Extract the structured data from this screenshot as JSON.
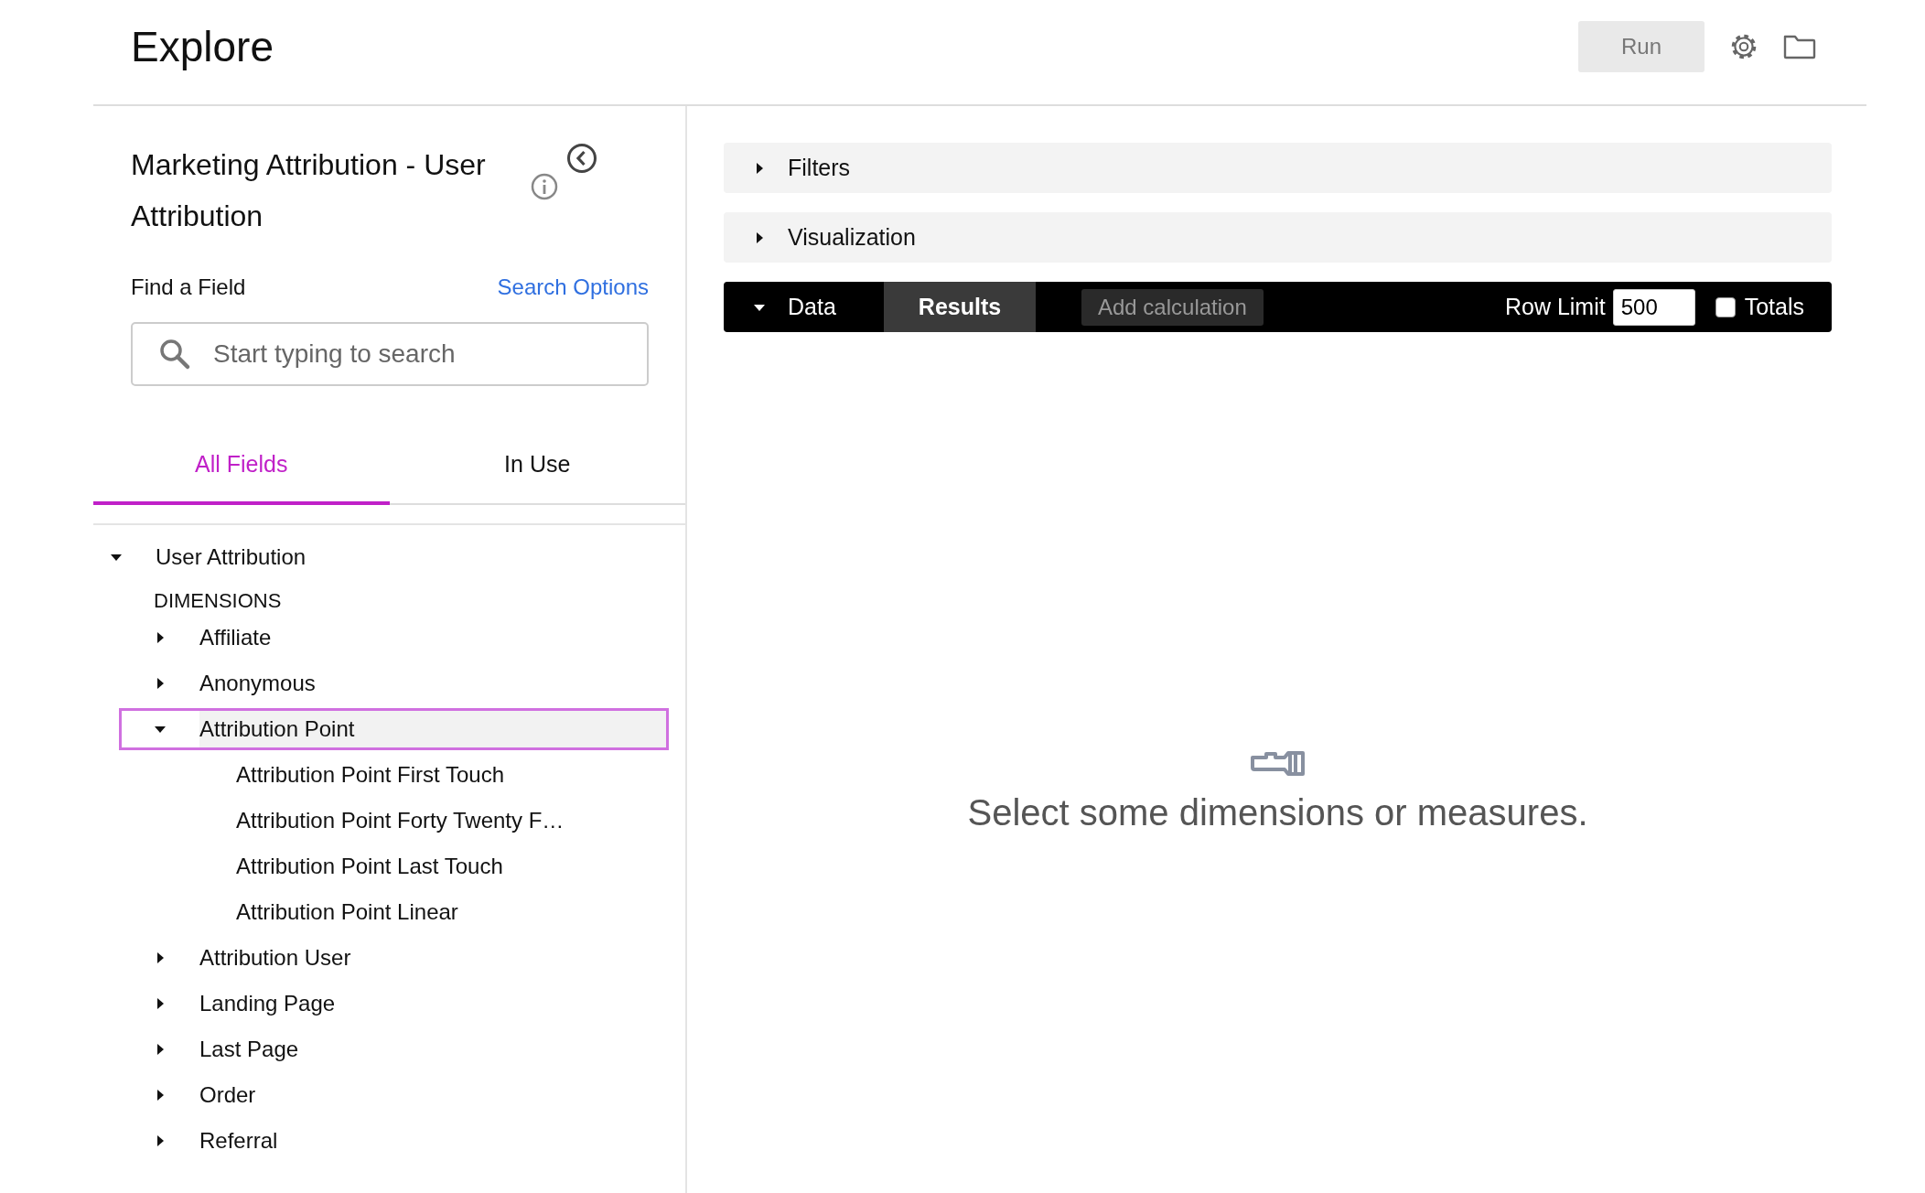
{
  "header": {
    "title": "Explore",
    "run_button": {
      "label": "Run",
      "disabled": true
    }
  },
  "field_picker": {
    "title": "Marketing Attribution - User Attribution",
    "find_label": "Find a Field",
    "search_options": "Search Options",
    "search": {
      "placeholder": "Start typing to search"
    },
    "tabs": [
      {
        "label": "All Fields",
        "selected": true
      },
      {
        "label": "In Use",
        "selected": false
      }
    ],
    "tree": [
      {
        "label": "User Attribution",
        "expanded": true,
        "selected": false,
        "sections": [
          {
            "heading": "DIMENSIONS",
            "items": [
              {
                "label": "Affiliate",
                "expanded": false,
                "selected": false
              },
              {
                "label": "Anonymous",
                "expanded": false,
                "selected": false
              },
              {
                "label": "Attribution Point",
                "expanded": true,
                "selected": true,
                "children": [
                  {
                    "label": "Attribution Point First Touch",
                    "selected": false
                  },
                  {
                    "label": "Attribution Point Forty Twenty F…",
                    "selected": false
                  },
                  {
                    "label": "Attribution Point Last Touch",
                    "selected": false
                  },
                  {
                    "label": "Attribution Point Linear",
                    "selected": false
                  }
                ]
              },
              {
                "label": "Attribution User",
                "expanded": false,
                "selected": false
              },
              {
                "label": "Landing Page",
                "expanded": false,
                "selected": false
              },
              {
                "label": "Last Page",
                "expanded": false,
                "selected": false
              },
              {
                "label": "Order",
                "expanded": false,
                "selected": false
              },
              {
                "label": "Referral",
                "expanded": false,
                "selected": false
              }
            ]
          }
        ]
      }
    ]
  },
  "sections": [
    {
      "label": "Filters",
      "expanded": false
    },
    {
      "label": "Visualization",
      "expanded": false
    }
  ],
  "data_bar": {
    "label": "Data",
    "expanded": true,
    "results_tab": {
      "label": "Results",
      "selected": true
    },
    "add_calculation": "Add calculation",
    "row_limit_label": "Row Limit",
    "row_limit": "500",
    "totals": {
      "label": "Totals",
      "checked": false
    }
  },
  "empty_message": "Select some dimensions or measures."
}
